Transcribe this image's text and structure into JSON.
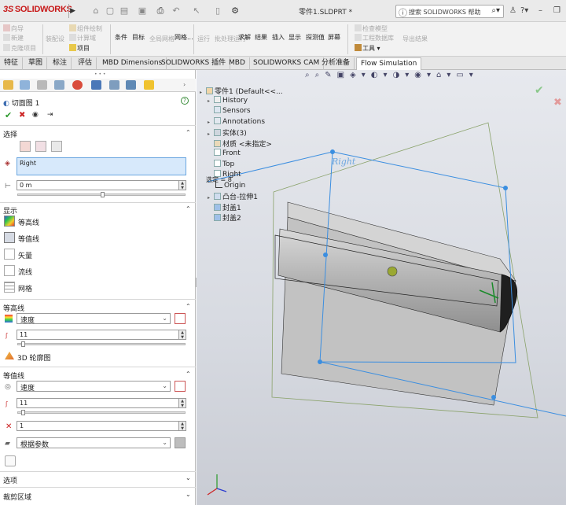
{
  "app": {
    "logo": "SOLIDWORKS",
    "logo_ds": "3S",
    "doc_title": "零件1.SLDPRT *",
    "search_placeholder": "搜索 SOLIDWORKS 帮助"
  },
  "ribbon": {
    "g1": [
      "向导",
      "新建",
      "克隆项目"
    ],
    "g2": [
      "装配设",
      "组件绘制",
      "计算域",
      "项目"
    ],
    "g3": [
      "条件",
      "目标",
      "全局网格"
    ],
    "g4": [
      "运行",
      "批处理运行",
      "求解",
      "结果",
      "插入",
      "显示",
      "探测值",
      "屏幕"
    ],
    "g5": [
      "检查模型",
      "工程数据库",
      "工具",
      "导出结果"
    ]
  },
  "tabs": [
    "特征",
    "草图",
    "标注",
    "评估",
    "MBD Dimensions",
    "SOLIDWORKS 插件",
    "MBD",
    "SOLIDWORKS CAM",
    "分析准备",
    "Flow Simulation"
  ],
  "panel": {
    "title": "切面图 1",
    "sec_select": "选择",
    "plane": "Right",
    "offset": "0 m",
    "sec_display": "显示",
    "display_items": [
      "等高线",
      "等值线",
      "矢量",
      "流线",
      "网格"
    ],
    "sec_contours": "等高线",
    "contours_param": "速度",
    "contours_levels": "11",
    "contours_3d": "3D 轮廓图",
    "sec_iso": "等值线",
    "iso_param": "速度",
    "iso_levels": "11",
    "iso_width": "1",
    "iso_color": "根据参数",
    "sec_options": "选项",
    "sec_crop": "裁剪区域"
  },
  "tree": {
    "root": "零件1 (Default<<...",
    "items": [
      "History",
      "Sensors",
      "Annotations",
      "实体(3)",
      "材质 <未指定>",
      "Front",
      "Top",
      "Right",
      "Origin",
      "凸台-拉伸1",
      "封盖1",
      "封盖2"
    ],
    "scale": "选定 = 8",
    "plane_label": "Right"
  },
  "colors": {
    "accent": "#2f6dd0",
    "selection": "#d8ecff",
    "plane_line": "#3b8ee0"
  }
}
